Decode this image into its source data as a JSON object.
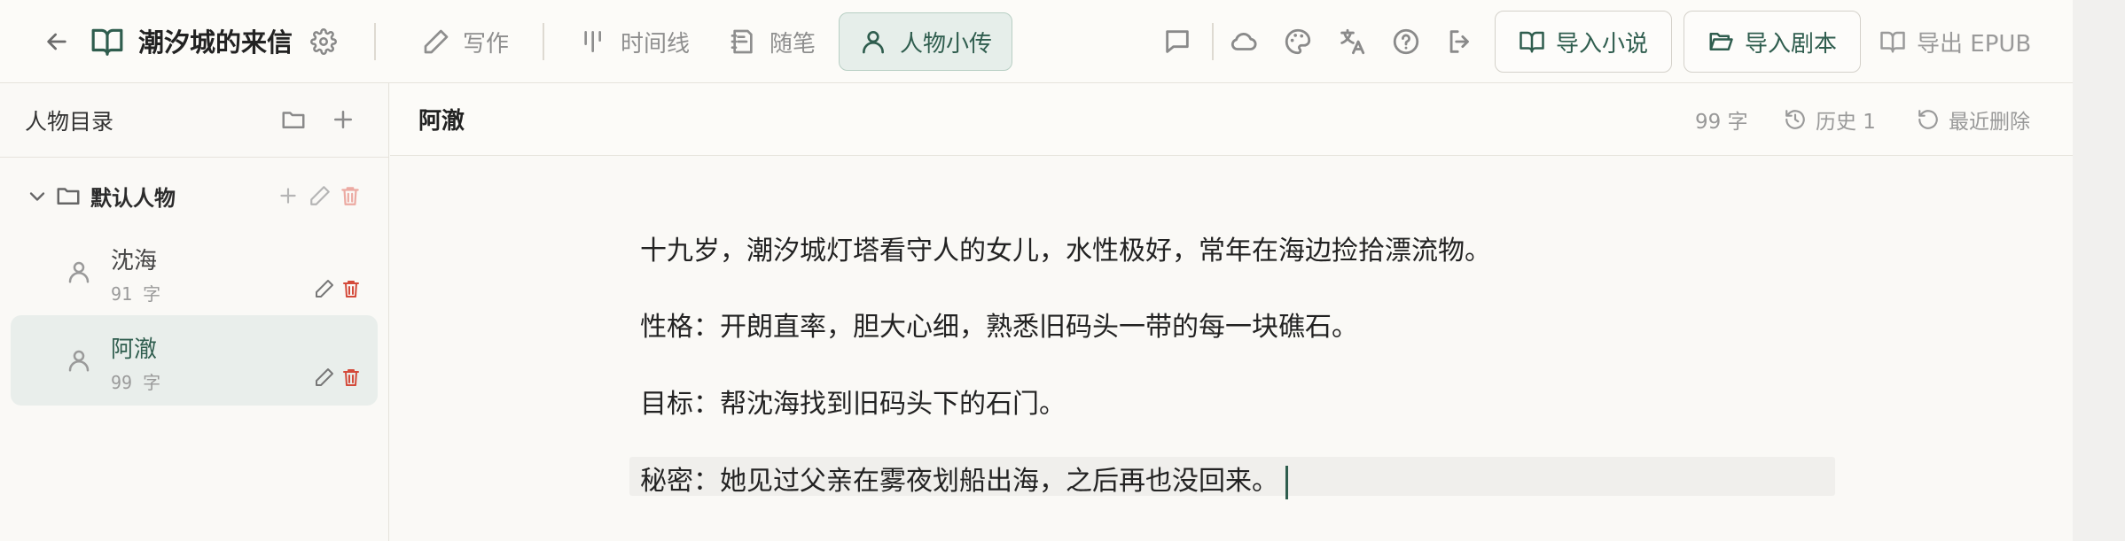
{
  "header": {
    "book_title": "潮汐城的来信",
    "nav_tabs": [
      {
        "label": "写作",
        "icon": "pen-icon"
      },
      {
        "label": "时间线",
        "icon": "timeline-icon"
      },
      {
        "label": "随笔",
        "icon": "notebook-icon"
      },
      {
        "label": "人物小传",
        "icon": "person-icon",
        "active": true
      }
    ],
    "actions": {
      "import_novel": "导入小说",
      "import_script": "导入剧本",
      "export_epub": "导出 EPUB"
    },
    "icons": [
      "comment-icon",
      "cloud-icon",
      "palette-icon",
      "translate-icon",
      "help-icon",
      "logout-icon"
    ]
  },
  "sidebar": {
    "title": "人物目录",
    "groups": [
      {
        "name": "默认人物",
        "characters": [
          {
            "name": "沈海",
            "count": "91 字"
          },
          {
            "name": "阿澈",
            "count": "99 字",
            "active": true
          }
        ]
      }
    ]
  },
  "editor": {
    "title": "阿澈",
    "word_count": "99 字",
    "history": "历史 1",
    "recent_deleted": "最近删除",
    "paragraphs": [
      "十九岁，潮汐城灯塔看守人的女儿，水性极好，常年在海边捡拾漂流物。",
      "性格：开朗直率，胆大心细，熟悉旧码头一带的每一块礁石。",
      "目标：帮沈海找到旧码头下的石门。",
      "秘密：她见过父亲在雾夜划船出海，之后再也没回来。"
    ]
  },
  "colors": {
    "accent": "#2f5d4e",
    "danger": "#d44a3a",
    "active_bg": "#e6eeea"
  }
}
